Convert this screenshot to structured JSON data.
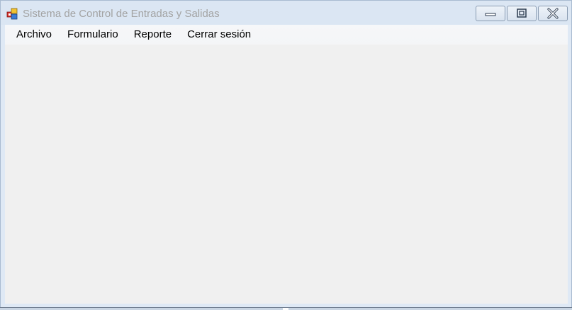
{
  "window": {
    "title": "Sistema de Control de Entradas y Salidas",
    "icon": "app-windows-icon",
    "controls": {
      "minimize_icon": "minimize-icon",
      "maximize_icon": "maximize-icon",
      "close_icon": "close-icon"
    }
  },
  "menubar": {
    "items": [
      {
        "label": "Archivo"
      },
      {
        "label": "Formulario"
      },
      {
        "label": "Reporte"
      },
      {
        "label": "Cerrar sesión"
      }
    ]
  },
  "colors": {
    "titlebar": "#dbe6f3",
    "client_background": "#f0f0f0",
    "title_text": "#a3a3a3"
  }
}
